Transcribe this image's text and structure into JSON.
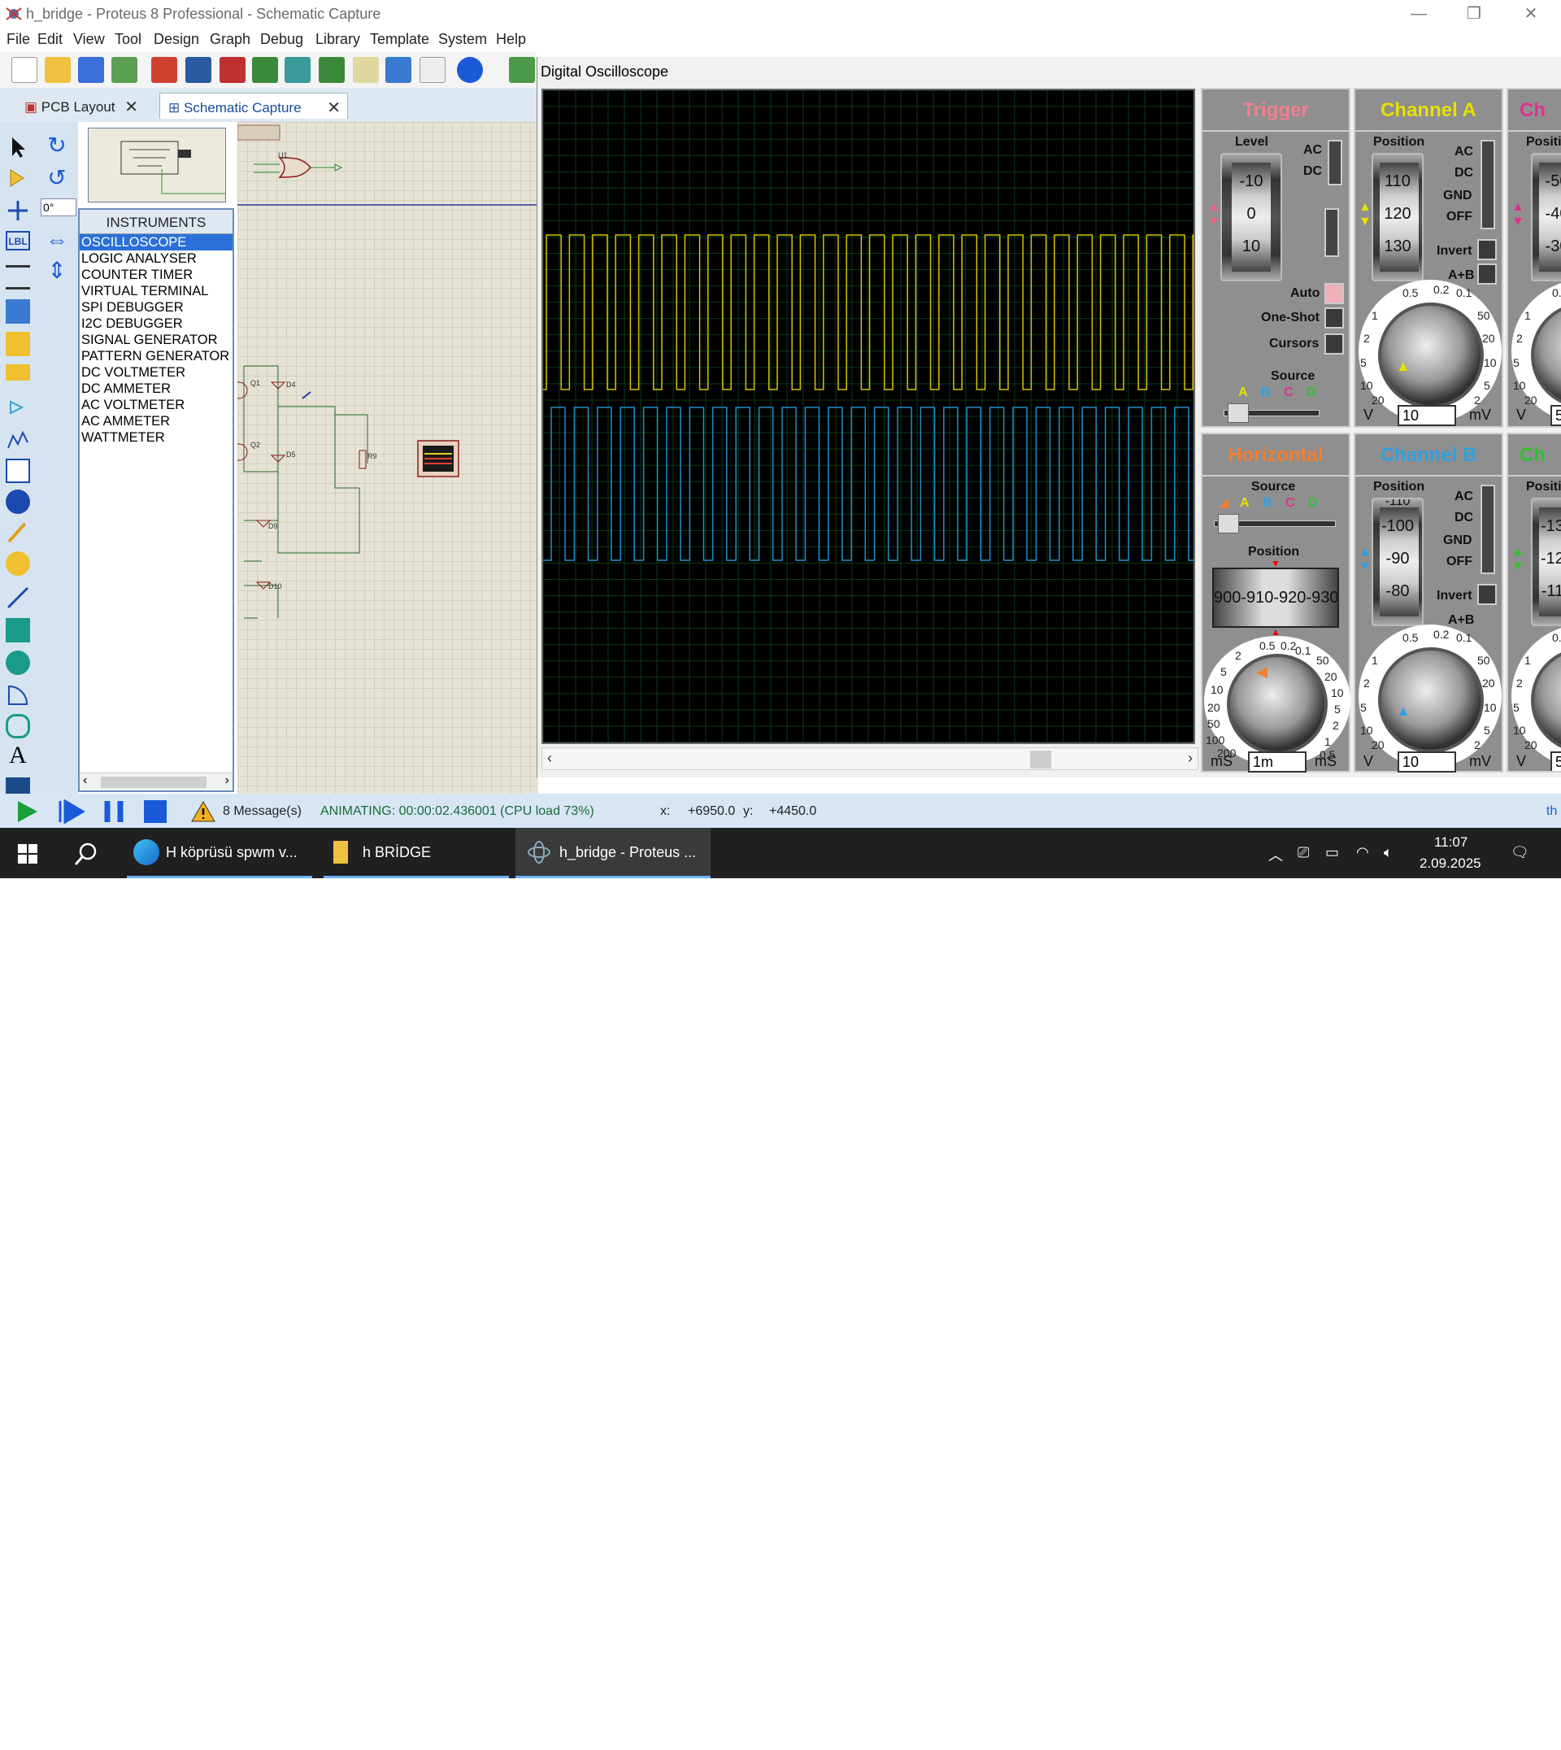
{
  "window": {
    "title": "h_bridge - Proteus 8 Professional - Schematic Capture"
  },
  "menu": [
    "File",
    "Edit",
    "View",
    "Tool",
    "Design",
    "Graph",
    "Debug",
    "Library",
    "Template",
    "System",
    "Help"
  ],
  "tabs": [
    {
      "label": "PCB Layout"
    },
    {
      "label": "Schematic Capture"
    }
  ],
  "angle": "0°",
  "instruments": {
    "header": "INSTRUMENTS",
    "items": [
      "OSCILLOSCOPE",
      "LOGIC ANALYSER",
      "COUNTER TIMER",
      "VIRTUAL TERMINAL",
      "SPI DEBUGGER",
      "I2C DEBUGGER",
      "SIGNAL GENERATOR",
      "PATTERN GENERATOR",
      "DC VOLTMETER",
      "DC AMMETER",
      "AC VOLTMETER",
      "AC AMMETER",
      "WATTMETER"
    ],
    "selected": 0
  },
  "schematic": {
    "labels": [
      "U1",
      "Q1",
      "D4",
      "Q2",
      "D5",
      "R9",
      "D9",
      "D10"
    ]
  },
  "oscilloscope": {
    "title": "Digital Oscilloscope",
    "trigger": {
      "title": "Trigger",
      "level_label": "Level",
      "ticks": [
        "-10",
        "0",
        "10"
      ],
      "coupling": [
        "AC",
        "DC"
      ],
      "modes": [
        "Auto",
        "One-Shot",
        "Cursors"
      ],
      "source_label": "Source",
      "sources": [
        "A",
        "B",
        "C",
        "D"
      ]
    },
    "channel_a": {
      "title": "Channel A",
      "position_label": "Position",
      "ticks": [
        "110",
        "120",
        "130"
      ],
      "coupling": [
        "AC",
        "DC",
        "GND",
        "OFF"
      ],
      "invert_label": "Invert",
      "ab_label": "A+B",
      "dial": [
        "0.5",
        "0.2",
        "0.1",
        "1",
        "50",
        "2",
        "20",
        "5",
        "10",
        "10",
        "5",
        "20",
        "2"
      ],
      "unit_left": "V",
      "unit_right": "mV",
      "value": "10"
    },
    "channel_c": {
      "title": "Ch",
      "position_label": "Positi",
      "ticks": [
        "-50",
        "-40",
        "-30"
      ],
      "dial_partial": [
        "0.",
        "1",
        "2",
        "5",
        "10",
        "20"
      ],
      "unit_left": "V",
      "value": "5"
    },
    "horizontal": {
      "title": "Horizontal",
      "source_label": "Source",
      "sources": [
        "A",
        "B",
        "C",
        "D"
      ],
      "position_label": "Position",
      "counter": "900-910-920-930",
      "dial": [
        "0.5",
        "0.2",
        "2",
        "0.1",
        "5",
        "50",
        "10",
        "20",
        "20",
        "10",
        "50",
        "5",
        "100",
        "2",
        "200",
        "1",
        "0.5"
      ],
      "unit_left": "mS",
      "unit_right": "mS",
      "value": "1m"
    },
    "channel_b": {
      "title": "Channel B",
      "position_label": "Position",
      "ticks": [
        "-110",
        "-100",
        "-90",
        "-80"
      ],
      "coupling": [
        "AC",
        "DC",
        "GND",
        "OFF"
      ],
      "invert_label": "Invert",
      "ab_label": "A+B",
      "dial": [
        "0.5",
        "0.2",
        "0.1",
        "1",
        "50",
        "2",
        "20",
        "5",
        "10",
        "10",
        "5",
        "20",
        "2"
      ],
      "unit_left": "V",
      "unit_right": "mV",
      "value": "10"
    },
    "channel_d": {
      "title": "Ch",
      "position_label": "Positi",
      "ticks": [
        "-130",
        "-120",
        "-110"
      ],
      "dial_partial": [
        "0.",
        "1",
        "2",
        "5",
        "10",
        "20"
      ],
      "unit_left": "V",
      "value": "5"
    },
    "trace_colors": {
      "a": "#d4c400",
      "b": "#1e8fc8"
    }
  },
  "status": {
    "messages": "8 Message(s)",
    "animating": "ANIMATING: 00:00:02.436001 (CPU load 73%)",
    "x_label": "x:",
    "x": "+6950.0",
    "y_label": "y:",
    "y": "+4450.0",
    "right": "th"
  },
  "taskbar": {
    "items": [
      {
        "label": "H köprüsü spwm v..."
      },
      {
        "label": "h BRİDGE"
      },
      {
        "label": "h_bridge - Proteus ..."
      }
    ],
    "time": "11:07",
    "date": "2.09.2025"
  }
}
